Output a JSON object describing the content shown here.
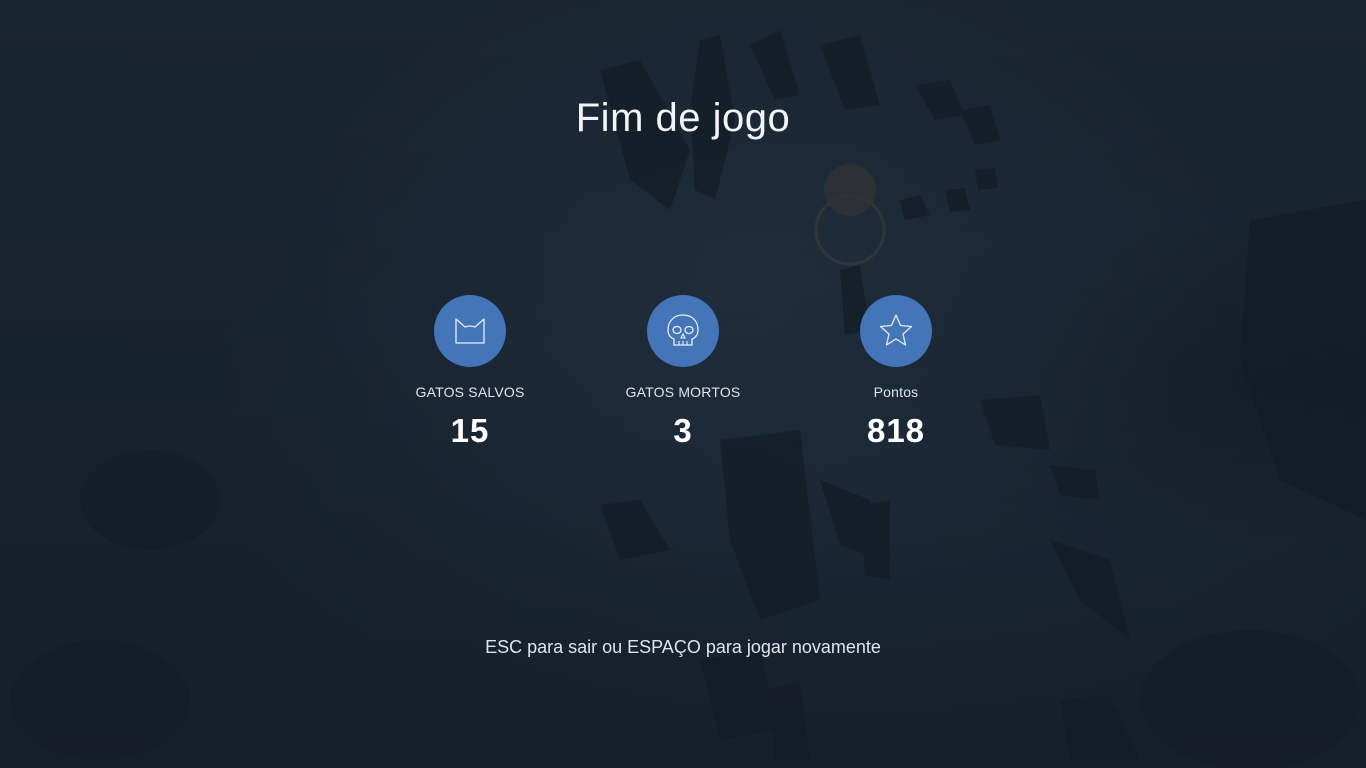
{
  "screen": {
    "title": "Fim de jogo",
    "hint": "ESC para sair ou ESPAÇO para jogar novamente"
  },
  "stats": [
    {
      "label": "GATOS SALVOS",
      "value": "15",
      "icon": "cat-icon"
    },
    {
      "label": "GATOS MORTOS",
      "value": "3",
      "icon": "skull-icon"
    },
    {
      "label": "Pontos",
      "value": "818",
      "icon": "star-icon"
    }
  ],
  "colors": {
    "badge": "#4375b8",
    "background": "#1b2633",
    "text": "#f2f4f6"
  }
}
